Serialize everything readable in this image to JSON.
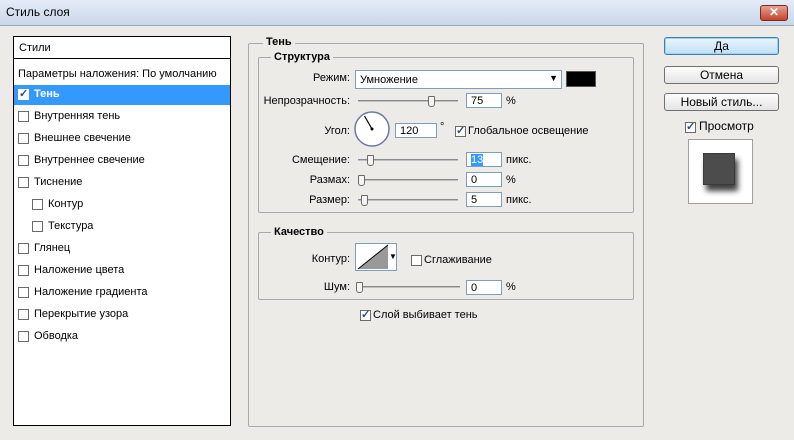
{
  "window": {
    "title": "Стиль слоя",
    "close_glyph": "✕"
  },
  "left_panel": {
    "header": "Стили",
    "blend_defaults": "Параметры наложения: По умолчанию",
    "items": [
      {
        "label": "Тень",
        "checked": true,
        "selected": true,
        "sub": false
      },
      {
        "label": "Внутренняя тень",
        "checked": false,
        "selected": false,
        "sub": false
      },
      {
        "label": "Внешнее свечение",
        "checked": false,
        "selected": false,
        "sub": false
      },
      {
        "label": "Внутреннее свечение",
        "checked": false,
        "selected": false,
        "sub": false
      },
      {
        "label": "Тиснение",
        "checked": false,
        "selected": false,
        "sub": false
      },
      {
        "label": "Контур",
        "checked": false,
        "selected": false,
        "sub": true
      },
      {
        "label": "Текстура",
        "checked": false,
        "selected": false,
        "sub": true
      },
      {
        "label": "Глянец",
        "checked": false,
        "selected": false,
        "sub": false
      },
      {
        "label": "Наложение цвета",
        "checked": false,
        "selected": false,
        "sub": false
      },
      {
        "label": "Наложение градиента",
        "checked": false,
        "selected": false,
        "sub": false
      },
      {
        "label": "Перекрытие узора",
        "checked": false,
        "selected": false,
        "sub": false
      },
      {
        "label": "Обводка",
        "checked": false,
        "selected": false,
        "sub": false
      }
    ]
  },
  "shadow": {
    "group_label": "Тень",
    "structure": {
      "group_label": "Структура",
      "mode_label": "Режим:",
      "mode_value": "Умножение",
      "shadow_color": "#000000",
      "opacity_label": "Непрозрачность:",
      "opacity_value": "75",
      "opacity_unit": "%",
      "opacity_fraction": 0.75,
      "angle_label": "Угол:",
      "angle_value": "120",
      "angle_unit": "°",
      "angle_degrees": 120,
      "global_light_label": "Глобальное освещение",
      "global_light_checked": true,
      "distance_label": "Смещение:",
      "distance_value": "13",
      "distance_unit": "пикс.",
      "distance_fraction": 0.1,
      "spread_label": "Размах:",
      "spread_value": "0",
      "spread_unit": "%",
      "spread_fraction": 0,
      "size_label": "Размер:",
      "size_value": "5",
      "size_unit": "пикс.",
      "size_fraction": 0.03
    },
    "quality": {
      "group_label": "Качество",
      "contour_label": "Контур:",
      "antialias_label": "Сглаживание",
      "antialias_checked": false,
      "noise_label": "Шум:",
      "noise_value": "0",
      "noise_unit": "%",
      "noise_fraction": 0
    },
    "knockout_label": "Слой выбивает тень",
    "knockout_checked": true
  },
  "buttons": {
    "ok": "Да",
    "cancel": "Отмена",
    "new_style": "Новый стиль...",
    "preview_label": "Просмотр",
    "preview_checked": true
  }
}
